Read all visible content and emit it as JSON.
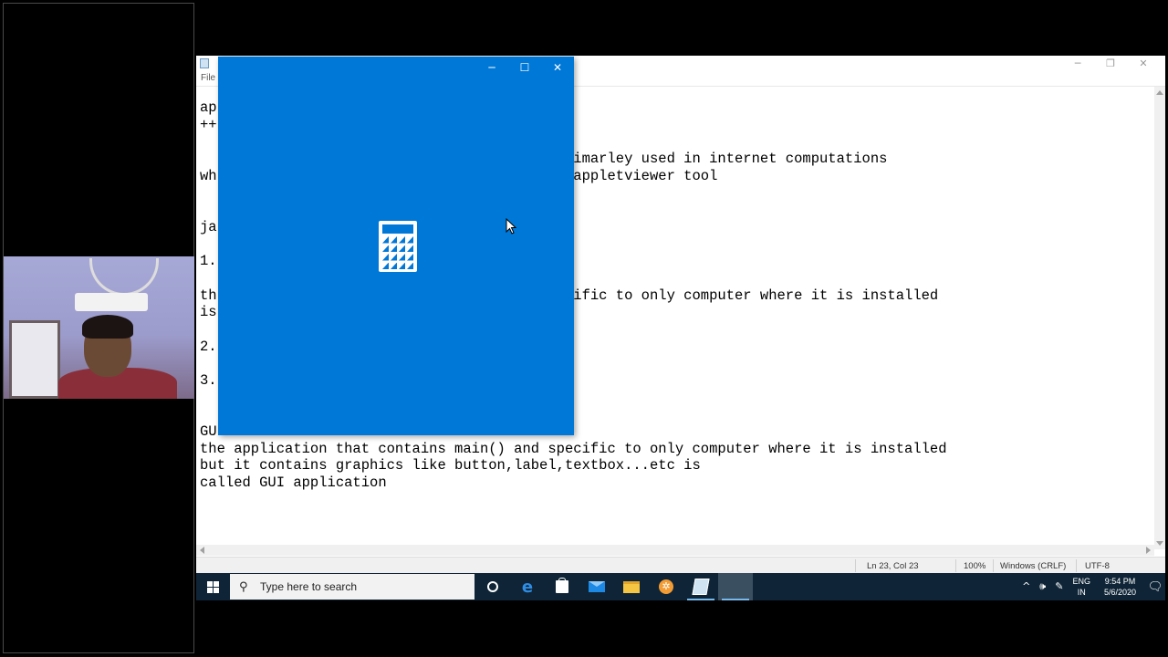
{
  "notepad": {
    "menu_file": "File",
    "controls": {
      "minimize": "─",
      "restore": "❐",
      "close": "✕"
    },
    "lines": [
      "ap",
      "++",
      "",
      "                                            imarley used in internet computations",
      "wh                                        e appletviewer tool",
      "",
      "",
      "ja",
      "",
      "1.",
      "",
      "th                                        ecific to only computer where it is installed",
      "is",
      "",
      "2.",
      "",
      "3.",
      "",
      "",
      "GU",
      "the application that contains main() and specific to only computer where it is installed",
      "but it contains graphics like button,label,textbox...etc is",
      "called GUI application"
    ],
    "status": {
      "position": "Ln 23, Col 23",
      "zoom": "100%",
      "line_ending": "Windows (CRLF)",
      "encoding": "UTF-8"
    }
  },
  "calculator": {
    "controls": {
      "minimize": "─",
      "maximize": "☐",
      "close": "✕"
    },
    "brand_color": "#0078d7",
    "logo_icon": "calculator-icon"
  },
  "taskbar": {
    "search_placeholder": "Type here to search",
    "apps": [
      "task-view-icon",
      "edge-icon",
      "store-icon",
      "mail-icon",
      "file-explorer-icon",
      "app-icon",
      "notepad-icon"
    ],
    "tray": {
      "chevron": "^",
      "volume": "🕪",
      "pen": "✎",
      "lang_top": "ENG",
      "lang_bottom": "IN",
      "time": "9:54 PM",
      "date": "5/6/2020",
      "notification": "🗨"
    }
  }
}
